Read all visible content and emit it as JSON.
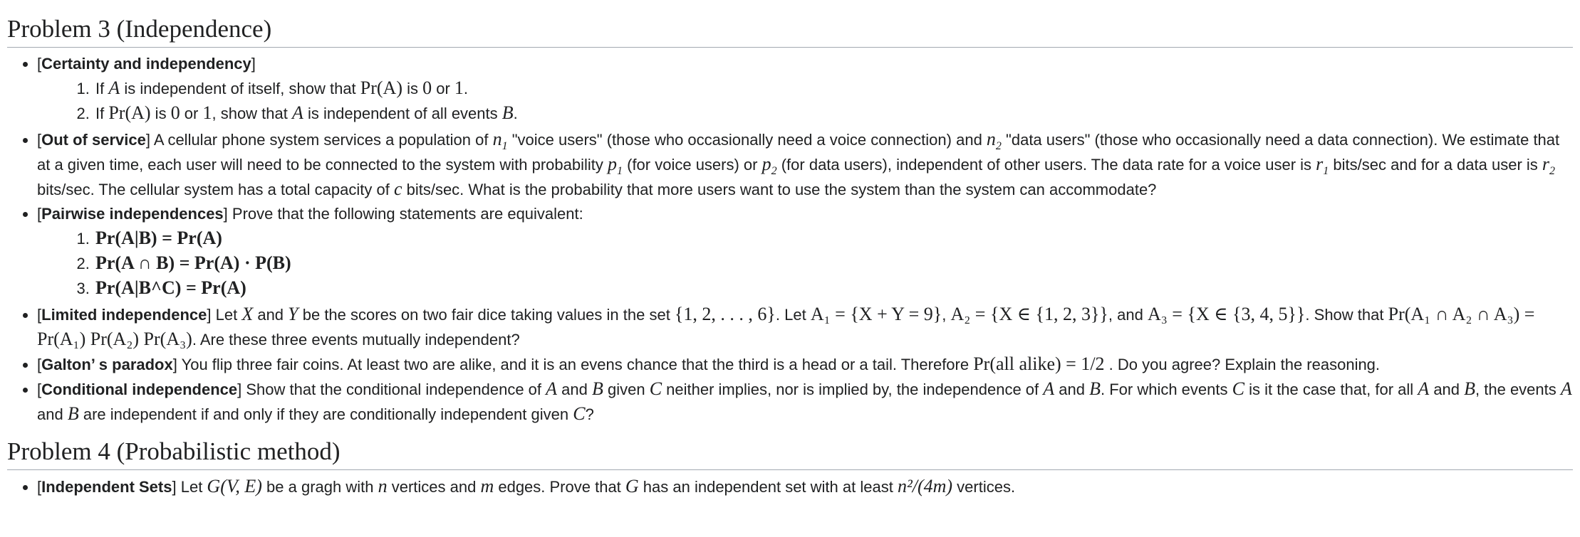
{
  "problem3": {
    "heading": "Problem 3 (Independence)",
    "items": [
      {
        "label": "Certainty and independency",
        "subitems": [
          {
            "t1": "If ",
            "A1": "A",
            "t2": " is independent of itself, show that ",
            "expr": "Pr(A)",
            "t3": " is ",
            "zero": "0",
            "t4": " or ",
            "one": "1",
            "t5": "."
          },
          {
            "t1": "If ",
            "expr": "Pr(A)",
            "t2": " is ",
            "zero": "0",
            "t3": " or ",
            "one": "1",
            "t4": ", show that ",
            "A1": "A",
            "t5": " is independent of all events ",
            "B1": "B",
            "t6": "."
          }
        ]
      },
      {
        "label": "Out of service",
        "text": {
          "t1": " A cellular phone system services a population of ",
          "n1": "n",
          "t2": " \"voice users\" (those who occasionally need a voice connection) and ",
          "n2": "n",
          "t3": " \"data users\" (those who occasionally need a data connection). We estimate that at a given time, each user will need to be connected to the system with probability ",
          "p1": "p",
          "t4": " (for voice users) or ",
          "p2": "p",
          "t5": " (for data users), independent of other users. The data rate for a voice user is ",
          "r1": "r",
          "t6": " bits/sec and for a data user is ",
          "r2": "r",
          "t7": " bits/sec. The cellular system has a total capacity of ",
          "c": "c",
          "t8": " bits/sec. What is the probability that more users want to use the system than the system can accommodate?",
          "sub1": "1",
          "sub2": "2"
        }
      },
      {
        "label": "Pairwise independences",
        "text": " Prove that the following statements are equivalent:",
        "equations": [
          "Pr(A|B) = Pr(A)",
          "Pr(A ∩ B) = Pr(A) · P(B)",
          "Pr(A|B^C) = Pr(A)"
        ]
      },
      {
        "label": "Limited independence",
        "text": {
          "t1": " Let ",
          "X": "X",
          "t2": " and ",
          "Y": "Y",
          "t3": " be the scores on two fair dice taking values in the set ",
          "set": "{1, 2, . . . , 6}",
          "t4": ". Let ",
          "A1def": "A₁ = {X + Y = 9}",
          "t5": ", ",
          "A2def": "A₂ = {X ∈ {1, 2, 3}}",
          "t6": ", and ",
          "A3def": "A₃ = {X ∈ {3, 4, 5}}",
          "t7": ". Show that ",
          "eq": "Pr(A₁ ∩ A₂ ∩ A₃) = Pr(A₁) Pr(A₂) Pr(A₃)",
          "t8": ". Are these three events mutually independent?"
        }
      },
      {
        "label": "Galton’ s paradox",
        "text": {
          "t1": " You flip three fair coins. At least two are alike, and it is an evens chance that the third is a head or a tail. Therefore ",
          "eq": "Pr(all alike) = 1/2",
          "t2": " . Do you agree? Explain the reasoning."
        }
      },
      {
        "label": "Conditional independence",
        "text": {
          "t1": " Show that the conditional independence of ",
          "A": "A",
          "t2": " and ",
          "B": "B",
          "t3": " given ",
          "C": "C",
          "t4": " neither implies, nor is implied by, the independence of ",
          "t5": ". For which events ",
          "t6": " is it the case that, for all ",
          "t7": ", the events ",
          "t8": " are independent if and only if they are conditionally independent given ",
          "t9": "?",
          "and": " and "
        }
      }
    ]
  },
  "problem4": {
    "heading": "Problem 4 (Probabilistic method)",
    "items": [
      {
        "label": "Independent Sets",
        "text": {
          "t1": " Let ",
          "G": "G(V, E)",
          "t2": " be a gragh with ",
          "n": "n",
          "t3": " vertices and ",
          "m": "m",
          "t4": " edges. Prove that ",
          "G2": "G",
          "t5": " has an independent set with at least ",
          "bound": "n²/(4m)",
          "t6": " vertices."
        }
      }
    ]
  }
}
